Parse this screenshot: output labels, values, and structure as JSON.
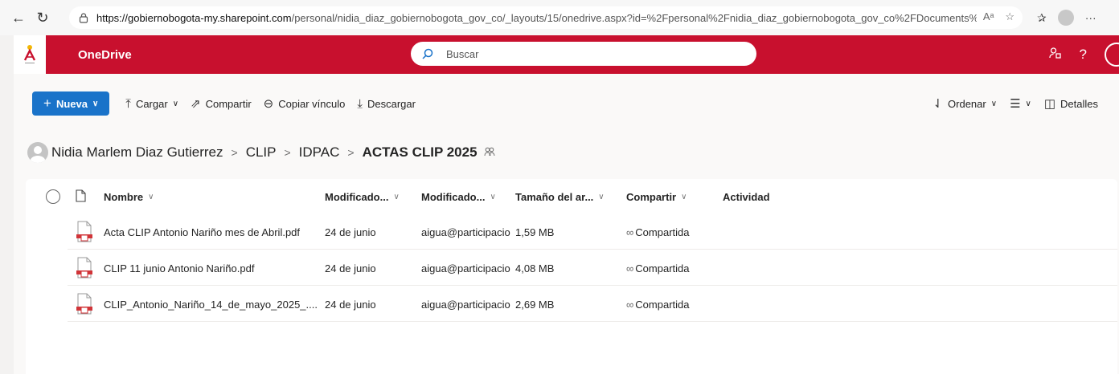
{
  "browser": {
    "url_host": "https://gobiernobogota-my.sharepoint.com",
    "url_path": "/personal/nidia_diaz_gobiernobogota_gov_co/_layouts/15/onedrive.aspx?id=%2Fpersonal%2Fnidia_diaz_gobiernobogota_gov_co%2FDocuments%2...",
    "read_aloud": "Aᵃ",
    "more": "···"
  },
  "appbar": {
    "title": "OneDrive",
    "search_placeholder": "Buscar",
    "help": "?"
  },
  "commands": {
    "new": "Nueva",
    "upload": "Cargar",
    "share": "Compartir",
    "copy_link": "Copiar vínculo",
    "download": "Descargar",
    "sort": "Ordenar",
    "details": "Detalles"
  },
  "breadcrumb": {
    "items": [
      "Nidia Marlem Diaz Gutierrez",
      "CLIP",
      "IDPAC"
    ],
    "current": "ACTAS CLIP 2025"
  },
  "table": {
    "columns": {
      "name": "Nombre",
      "modified": "Modificado...",
      "modified_by": "Modificado...",
      "size": "Tamaño del ar...",
      "sharing": "Compartir",
      "activity": "Actividad"
    },
    "rows": [
      {
        "name": "Acta CLIP Antonio Nariño mes de Abril.pdf",
        "modified": "24 de junio",
        "modified_by": "aigua@participacio",
        "size": "1,59 MB",
        "sharing": "Compartida"
      },
      {
        "name": "CLIP 11 junio Antonio Nariño.pdf",
        "modified": "24 de junio",
        "modified_by": "aigua@participacio",
        "size": "4,08 MB",
        "sharing": "Compartida"
      },
      {
        "name": "CLIP_Antonio_Nariño_14_de_mayo_2025_....",
        "modified": "24 de junio",
        "modified_by": "aigua@participacio",
        "size": "2,69 MB",
        "sharing": "Compartida"
      }
    ]
  },
  "colors": {
    "appbar": "#c8102e",
    "primary_button": "#1a73c9",
    "pdf_icon": "#d13438"
  }
}
